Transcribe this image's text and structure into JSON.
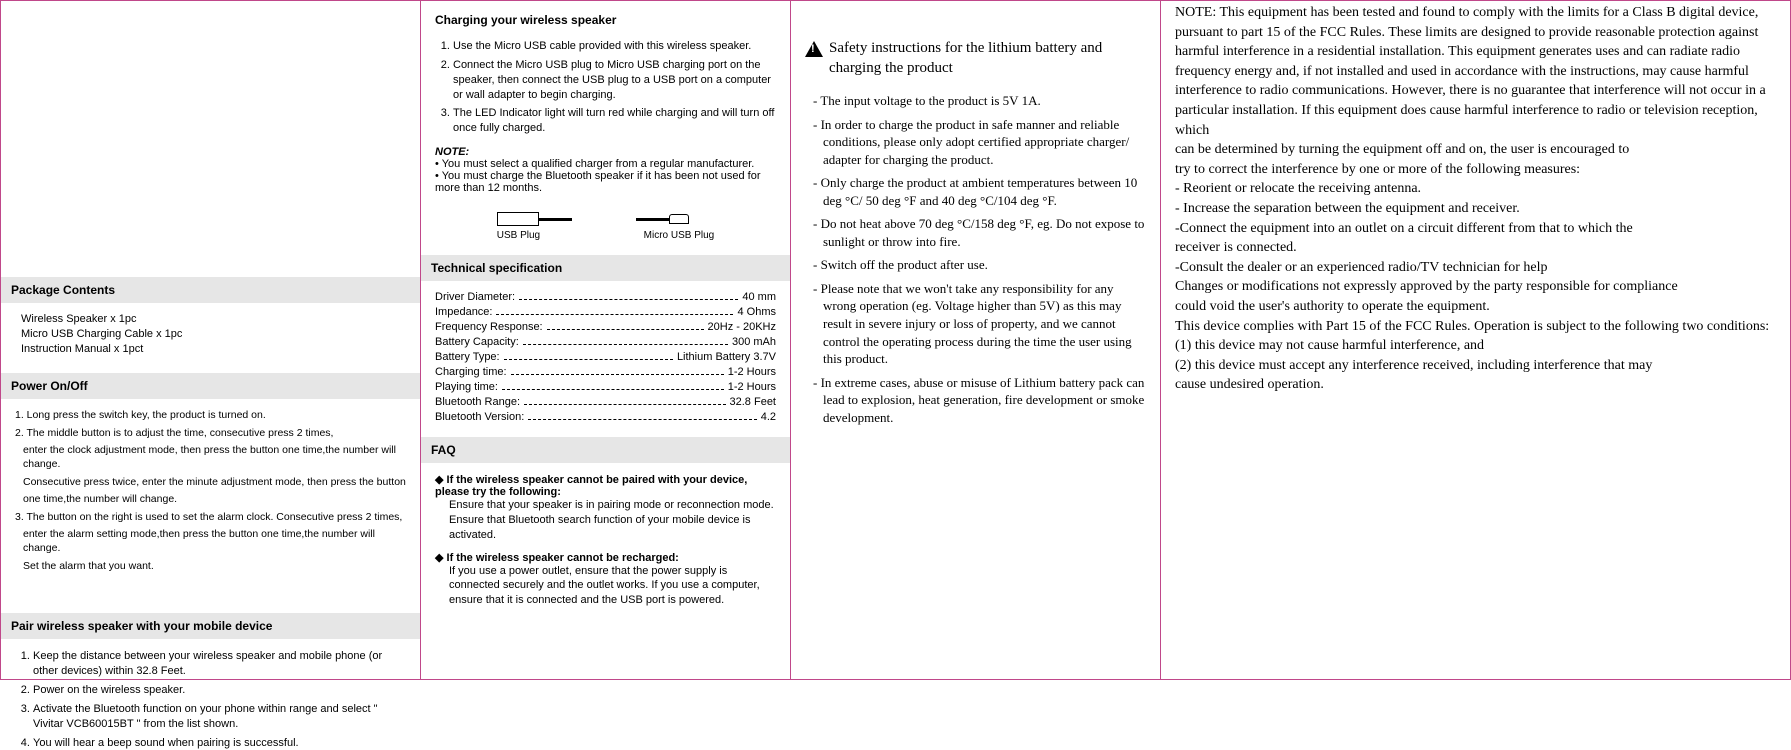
{
  "col1": {
    "package_h": "Package Contents",
    "package": [
      "Wireless Speaker x 1pc",
      "Micro USB Charging Cable x 1pc",
      "Instruction Manual x 1pct"
    ],
    "power_h": "Power On/Off",
    "power_1": "1. Long press the switch key, the product is turned on.",
    "power_2a": "2. The middle button is to adjust the time, consecutive press 2 times,",
    "power_2b": "enter the clock adjustment mode, then press the button one time,the number will change.",
    "power_2c": "Consecutive press twice, enter the minute adjustment mode, then press the button",
    "power_2d": "one time,the number will change.",
    "power_3a": "3. The button on the right is used to set the alarm clock. Consecutive press 2 times,",
    "power_3b": "enter the alarm setting mode,then press the button one time,the number will change.",
    "power_3c": "Set the alarm that you want.",
    "pair_h": "Pair wireless speaker with your mobile device",
    "pair": [
      "Keep the distance between your wireless speaker and mobile phone (or other devices) within 32.8 Feet.",
      "Power on the wireless speaker.",
      "Activate the Bluetooth function on your phone within range and select \" Vivitar VCB60015BT \" from the list shown.",
      "You will hear a beep sound when pairing is successful."
    ]
  },
  "col2": {
    "charge_h": "Charging your wireless speaker",
    "charge": [
      "Use the Micro USB cable provided with this wireless speaker.",
      "Connect the Micro USB plug to Micro USB charging port on the speaker, then connect the USB plug to a USB port on a computer or wall adapter to begin charging.",
      "The LED Indicator light will turn red while charging and will turn off once fully charged."
    ],
    "note_h": "NOTE:",
    "note": [
      "You must select a qualified charger from a regular manufacturer.",
      "You must charge the Bluetooth speaker if it has been not used for more than 12 months."
    ],
    "usb_lbl": "USB Plug",
    "micro_lbl": "Micro USB Plug",
    "tech_h": "Technical specification",
    "specs": [
      {
        "k": "Driver Diameter:",
        "v": "40 mm"
      },
      {
        "k": "Impedance:",
        "v": "4 Ohms"
      },
      {
        "k": "Frequency Response:",
        "v": "20Hz - 20KHz"
      },
      {
        "k": "Battery Capacity:",
        "v": "300 mAh"
      },
      {
        "k": "Battery Type:",
        "v": "Lithium Battery 3.7V"
      },
      {
        "k": "Charging time:",
        "v": "1-2 Hours"
      },
      {
        "k": "Playing time:",
        "v": "1-2 Hours"
      },
      {
        "k": "Bluetooth Range:",
        "v": "32.8 Feet"
      },
      {
        "k": "Bluetooth Version:",
        "v": "4.2"
      }
    ],
    "faq_h": "FAQ",
    "faq1_q": "If the wireless speaker cannot be paired with your device, please try the following:",
    "faq1_a1": "Ensure that your speaker is in pairing mode or reconnection mode.",
    "faq1_a2": "Ensure that Bluetooth search function of your mobile device is activated.",
    "faq2_q": "If the wireless speaker cannot be recharged:",
    "faq2_a": "If you use a power outlet, ensure that the power supply is connected securely and the outlet works. If you use a computer, ensure that it is connected and the USB port is powered."
  },
  "col3": {
    "title": "Safety instructions for the lithium battery and charging the product",
    "items": [
      "The input voltage to the product is 5V 1A.",
      "In order to charge the product in safe manner and reliable conditions, please only adopt certified appropriate charger/ adapter for charging the product.",
      "Only charge the product at ambient temperatures between 10 deg °C/ 50 deg °F and 40 deg °C/104 deg °F.",
      "Do not heat above 70 deg °C/158 deg °F, eg. Do not expose to sunlight or throw into fire.",
      "Switch off the product after use.",
      "Please note that we won't take any responsibility for any wrong operation (eg. Voltage higher than 5V) as this may result in severe injury or loss of property, and we cannot control the operating process during the time the user using this product.",
      "In extreme cases, abuse or misuse of Lithium battery pack can lead to explosion, heat generation, fire development or smoke development."
    ]
  },
  "col4": {
    "p1": "NOTE: This equipment has been tested and found to comply with the limits for a Class B digital device, pursuant to part 15 of the FCC Rules. These limits are designed to provide reasonable protection against harmful interference in a residential installation. This equipment generates uses and can radiate radio frequency energy and, if not installed and used in accordance with the instructions, may cause harmful interference to radio communications. However, there is no guarantee that interference will not occur in a particular installation. If this equipment does cause harmful interference to radio or television reception, which",
    "p2": "can be determined by turning the equipment off and on, the user is encouraged to",
    "p3": "try to correct the interference by one or more of the following measures:",
    "m1": "- Reorient or relocate the receiving antenna.",
    "m2": "- Increase the separation between the equipment and receiver.",
    "m3": "-Connect the equipment into an outlet on a circuit different from that to which the",
    "m3b": "receiver is connected.",
    "m4": "-Consult the dealer or an experienced radio/TV technician for help",
    "p4": "Changes or modifications not expressly approved by the party responsible for compliance",
    "p5": "could void the user's authority to operate the equipment.",
    "p6": "This device complies with Part 15 of the FCC Rules. Operation is subject to the following two conditions:",
    "c1": "(1) this device may not cause harmful interference, and",
    "c2": "(2) this device must accept any interference received, including interference that may",
    "c3": "cause undesired operation."
  }
}
